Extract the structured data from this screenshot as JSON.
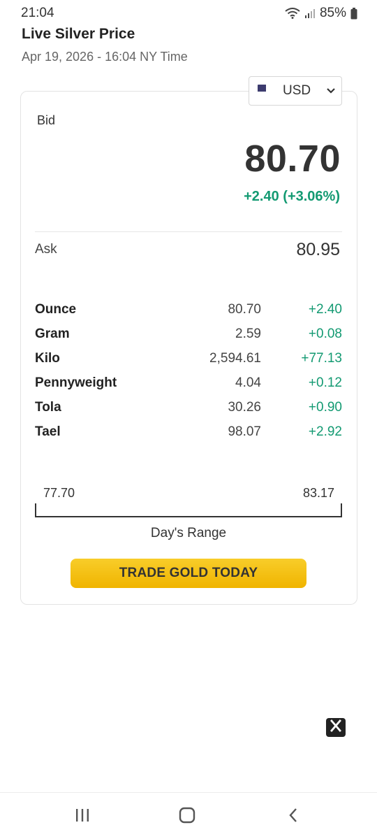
{
  "status": {
    "time": "21:04",
    "battery": "85%",
    "icons": [
      "wifi-icon",
      "signal-icon",
      "battery-icon"
    ]
  },
  "header": {
    "title": "Live Silver Price",
    "subtitle": "Apr 19, 2026 - 16:04 NY Time"
  },
  "currency": {
    "selected": "USD",
    "flag": "us-flag-icon"
  },
  "quote": {
    "bid_label": "Bid",
    "bid_value": "80.70",
    "bid_change": "+2.40 (+3.06%)",
    "ask_label": "Ask",
    "ask_value": "80.95"
  },
  "units": [
    {
      "name": "Ounce",
      "price": "80.70",
      "change": "+2.40"
    },
    {
      "name": "Gram",
      "price": "2.59",
      "change": "+0.08"
    },
    {
      "name": "Kilo",
      "price": "2,594.61",
      "change": "+77.13"
    },
    {
      "name": "Pennyweight",
      "price": "4.04",
      "change": "+0.12"
    },
    {
      "name": "Tola",
      "price": "30.26",
      "change": "+0.90"
    },
    {
      "name": "Tael",
      "price": "98.07",
      "change": "+2.92"
    }
  ],
  "range": {
    "low": "77.70",
    "high": "83.17",
    "label": "Day's Range"
  },
  "cta": {
    "label": "TRADE GOLD TODAY"
  },
  "colors": {
    "positive": "#139a72",
    "button": "#f5c211"
  }
}
